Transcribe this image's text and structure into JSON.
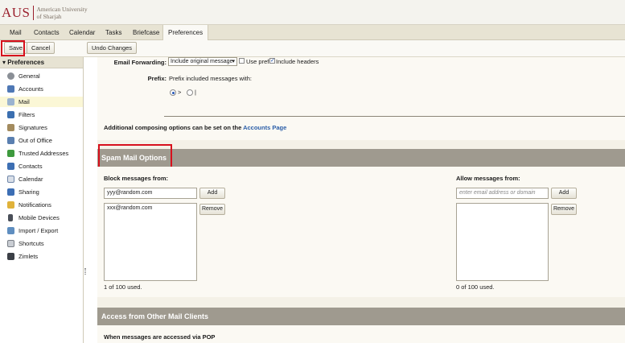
{
  "header": {
    "logo_abbr": "AUS",
    "logo_line1": "American University",
    "logo_line2": "of Sharjah"
  },
  "tabs": [
    {
      "label": "Mail"
    },
    {
      "label": "Contacts"
    },
    {
      "label": "Calendar"
    },
    {
      "label": "Tasks"
    },
    {
      "label": "Briefcase"
    },
    {
      "label": "Preferences"
    }
  ],
  "toolbar": {
    "save": "Save",
    "cancel": "Cancel",
    "undo": "Undo Changes"
  },
  "sidebar": {
    "title": "Preferences",
    "items": [
      {
        "label": "General",
        "icon": "gear-icon"
      },
      {
        "label": "Accounts",
        "icon": "accounts-icon"
      },
      {
        "label": "Mail",
        "icon": "mail-icon"
      },
      {
        "label": "Filters",
        "icon": "filter-icon"
      },
      {
        "label": "Signatures",
        "icon": "signature-icon"
      },
      {
        "label": "Out of Office",
        "icon": "out-of-office-icon"
      },
      {
        "label": "Trusted Addresses",
        "icon": "shield-icon"
      },
      {
        "label": "Contacts",
        "icon": "contacts-icon"
      },
      {
        "label": "Calendar",
        "icon": "calendar-icon"
      },
      {
        "label": "Sharing",
        "icon": "sharing-icon"
      },
      {
        "label": "Notifications",
        "icon": "notifications-icon"
      },
      {
        "label": "Mobile Devices",
        "icon": "mobile-icon"
      },
      {
        "label": "Import / Export",
        "icon": "import-export-icon"
      },
      {
        "label": "Shortcuts",
        "icon": "shortcuts-icon"
      },
      {
        "label": "Zimlets",
        "icon": "zimlets-icon"
      }
    ]
  },
  "composing": {
    "forwarding_label": "Email Forwarding:",
    "forwarding_value": "Include original message",
    "use_prefix_label": "Use prefix",
    "use_prefix_checked": false,
    "include_headers_label": "Include headers",
    "include_headers_checked": true,
    "prefix_label": "Prefix:",
    "prefix_desc": "Prefix included messages with:",
    "prefix_opt1": ">",
    "prefix_opt2": "|",
    "prefix_selected": ">",
    "additional_text": "Additional composing options can be set on the",
    "additional_link": "Accounts Page"
  },
  "spam": {
    "title": "Spam Mail Options",
    "block_label": "Block messages from:",
    "block_input": "yyy@random.com",
    "block_list": [
      "xxx@random.com"
    ],
    "block_count": "1 of 100 used.",
    "allow_label": "Allow messages from:",
    "allow_placeholder": "enter email address or domain",
    "allow_count": "0 of 100 used.",
    "add": "Add",
    "remove": "Remove"
  },
  "other_clients": {
    "title": "Access from Other Mail Clients",
    "pop_label": "When messages are accessed via POP"
  },
  "colors": {
    "brand": "#9a1f2c",
    "highlight": "#d7101c",
    "section_bar": "#9f9a8f",
    "link": "#2b5ea8"
  }
}
